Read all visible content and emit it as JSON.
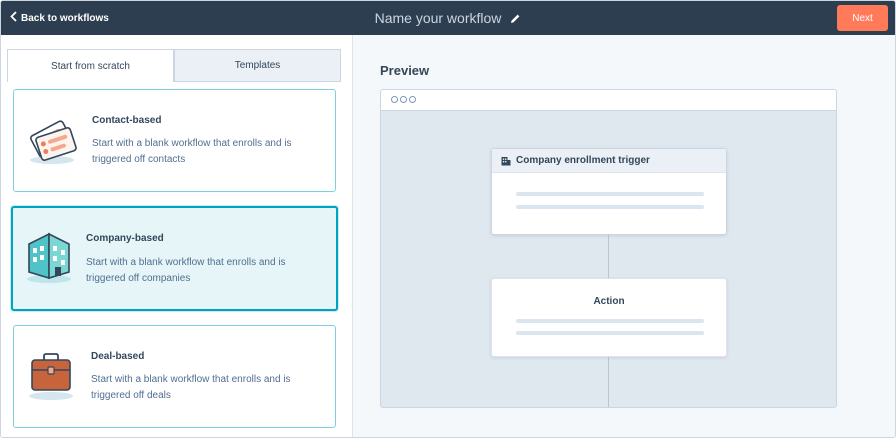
{
  "header": {
    "back_label": "Back to workflows",
    "workflow_title": "Name your workflow",
    "next_label": "Next"
  },
  "tabs": [
    {
      "label": "Start from scratch",
      "active": true
    },
    {
      "label": "Templates",
      "active": false
    }
  ],
  "cards": [
    {
      "title": "Contact-based",
      "description": "Start with a blank workflow that enrolls and is triggered off contacts",
      "icon": "contact-cards-icon",
      "selected": false
    },
    {
      "title": "Company-based",
      "description": "Start with a blank workflow that enrolls and is triggered off companies",
      "icon": "company-building-icon",
      "selected": true
    },
    {
      "title": "Deal-based",
      "description": "Start with a blank workflow that enrolls and is triggered off deals",
      "icon": "briefcase-icon",
      "selected": false
    }
  ],
  "preview": {
    "title": "Preview",
    "trigger_label": "Company enrollment trigger",
    "action_label": "Action"
  },
  "colors": {
    "header_bg": "#2d3e50",
    "accent_orange": "#ff7a59",
    "selected_teal": "#00a4bd",
    "selected_bg": "#e5f5f8"
  }
}
